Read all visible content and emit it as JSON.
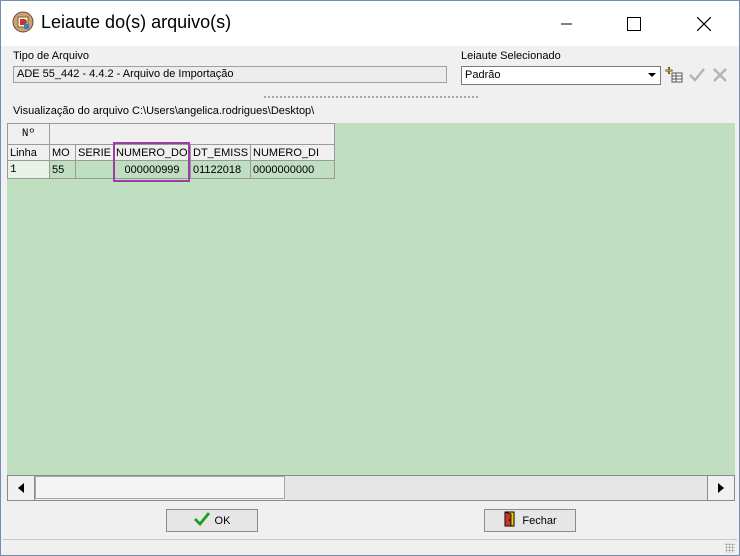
{
  "window": {
    "title": "Leiaute do(s) arquivo(s)"
  },
  "tipo_arquivo": {
    "label": "Tipo de Arquivo",
    "value": "ADE 55_442 - 4.4.2 - Arquivo de Importação"
  },
  "leiaute": {
    "label": "Leiaute Selecionado",
    "selected": "Padrão"
  },
  "preview": {
    "path_label": "Visualização do arquivo C:\\Users\\angelica.rodrigues\\Desktop\\"
  },
  "grid": {
    "corner_top": "Nº",
    "corner_bottom": "Linha",
    "columns": [
      "MO",
      "SERIE",
      "NUMERO_DO",
      "DT_EMISS",
      "NUMERO_DI"
    ],
    "rows": [
      {
        "linha": "1",
        "cells": [
          "55",
          "",
          "000000999",
          "01122018",
          "0000000000"
        ]
      }
    ],
    "highlighted_column": "NUMERO_DO"
  },
  "buttons": {
    "ok": "OK",
    "fechar": "Fechar"
  },
  "icons": {
    "app": "app-logo-icon",
    "add_layout": "add-layout-icon",
    "confirm": "check-icon",
    "delete": "delete-icon",
    "ok": "checkmark-icon",
    "fechar": "exit-door-icon"
  },
  "colors": {
    "grid_background": "#c0dec0",
    "highlight_border": "#9b3fa6"
  }
}
